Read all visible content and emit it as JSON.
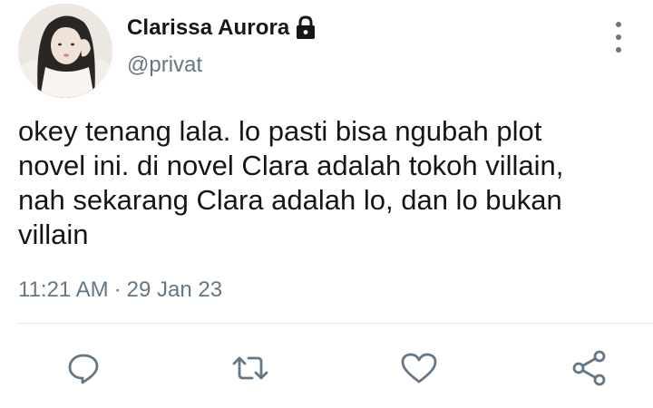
{
  "tweet": {
    "author": {
      "display_name": "Clarissa Aurora",
      "handle": "@privat",
      "avatar": "profile-photo",
      "protected_icon": "lock-icon"
    },
    "more_icon": "more-vertical-icon",
    "text": "okey tenang lala. lo pasti bisa ngubah plot\nnovel ini. di novel Clara adalah tokoh villain,\nnah sekarang Clara adalah lo, dan lo bukan\nvillain",
    "time": "11:21 AM",
    "separator": "·",
    "date": "29 Jan 23",
    "actions": {
      "reply_icon": "reply-icon",
      "retweet_icon": "retweet-icon",
      "like_icon": "heart-icon",
      "share_icon": "share-icon"
    },
    "colors": {
      "text": "#14171a",
      "secondary": "#657786",
      "divider": "#e1e8ed"
    }
  }
}
